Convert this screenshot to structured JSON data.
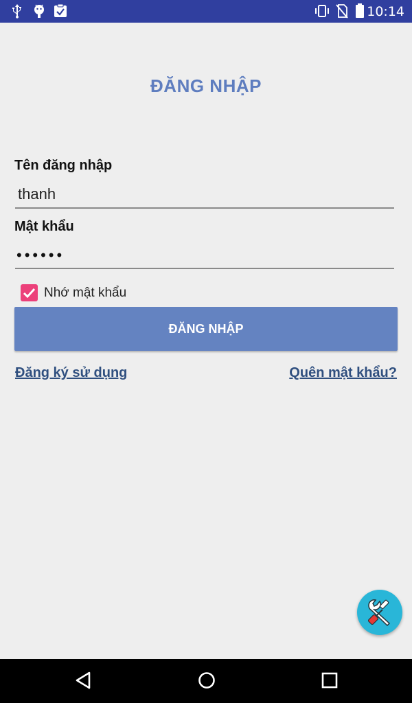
{
  "status_bar": {
    "time": "10:14",
    "icons_left": [
      "usb-icon",
      "android-debug-icon",
      "clipboard-check-icon"
    ],
    "icons_right": [
      "vibrate-icon",
      "no-sim-icon",
      "battery-icon"
    ]
  },
  "login": {
    "title": "ĐĂNG NHẬP",
    "username_label": "Tên đăng nhập",
    "username_value": "thanh",
    "password_label": "Mật khẩu",
    "password_value": "••••••",
    "remember_label": "Nhớ mật khẩu",
    "remember_checked": true,
    "submit_label": "ĐĂNG NHẬP",
    "register_link": "Đăng ký sử dụng",
    "forgot_link": "Quên mật khẩu?"
  },
  "fab": {
    "icon": "tools-icon"
  },
  "nav_bar": {
    "buttons": [
      "back-icon",
      "home-icon",
      "recents-icon"
    ]
  },
  "colors": {
    "status_bar": "#303f9f",
    "accent": "#6483c1",
    "title": "#5e7dbf",
    "checkbox": "#ec407a",
    "fab": "#29b6d8",
    "link": "#2f4f7f",
    "background": "#eeeeee"
  }
}
